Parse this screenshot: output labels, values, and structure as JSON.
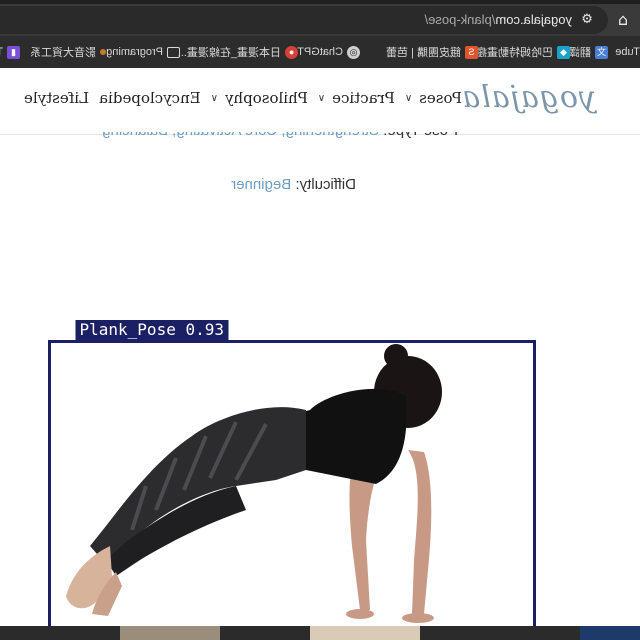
{
  "browser": {
    "url_host": "yogajala.com",
    "url_path": "/plank-pose/",
    "bookmarks": [
      {
        "label": "uTube",
        "icon": "youtube-icon"
      },
      {
        "label": "翻譯",
        "icon": "translate-icon"
      },
      {
        "label": "巴哈姆特動畫瘋",
        "icon": "bahamut-icon"
      },
      {
        "label": "餓皮團購 | 芭蕾",
        "icon": "shop-icon"
      },
      {
        "label": "ChatGPT",
        "icon": "chatgpt-icon"
      },
      {
        "label": "日本漫畫_在線漫畫...",
        "icon": "manga-icon"
      },
      {
        "label": "Programing",
        "icon": "folder-icon"
      },
      {
        "label": "影音大資工系",
        "icon": "bookmark-icon"
      },
      {
        "label": "T",
        "icon": "purple-icon"
      }
    ]
  },
  "site": {
    "logo": "yogajala",
    "nav": [
      {
        "label": "Poses"
      },
      {
        "label": "Practice"
      },
      {
        "label": "Philosophy"
      },
      {
        "label": "Encyclopedia"
      },
      {
        "label": "Lifestyle"
      }
    ]
  },
  "article": {
    "pose_type_label": "Pose Type:",
    "pose_type_value": "Strengthening, Core Activating, Balancing",
    "difficulty_label": "Difficulty:",
    "difficulty_value": "Beginner"
  },
  "detection": {
    "label": "Plank_Pose 0.93",
    "box_color": "#1b1f63"
  }
}
